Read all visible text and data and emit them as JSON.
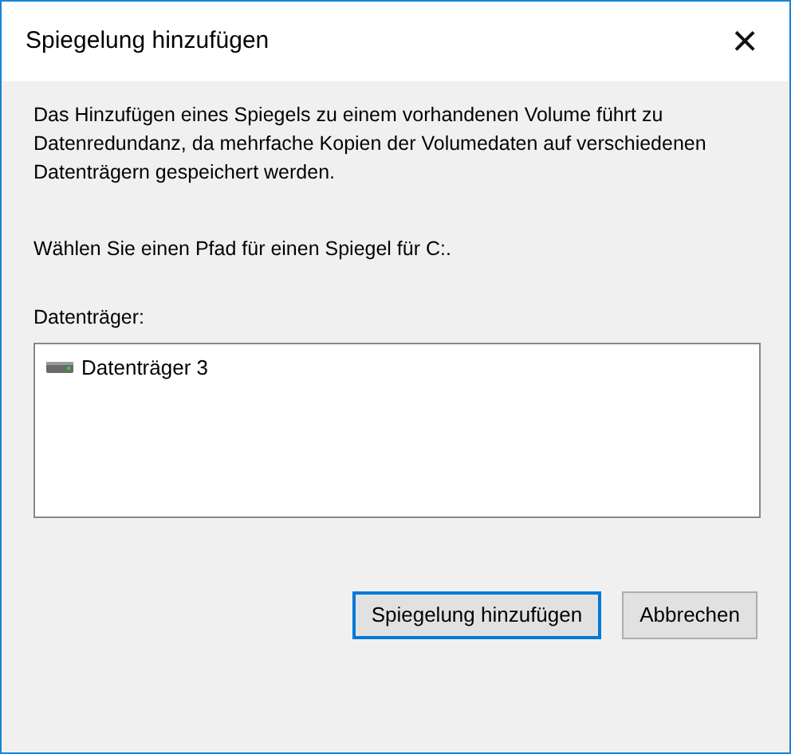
{
  "window": {
    "title": "Spiegelung hinzufügen",
    "close": "×"
  },
  "description": "Das Hinzufügen eines Spiegels zu einem vorhandenen Volume führt zu Datenredundanz, da mehrfache Kopien der Volumedaten auf verschiedenen Datenträgern gespeichert werden.",
  "prompt": "Wählen Sie einen Pfad für einen Spiegel für C:.",
  "disk_list": {
    "label": "Datenträger:",
    "items": [
      {
        "label": "Datenträger 3",
        "selected": false
      }
    ]
  },
  "buttons": [
    {
      "label": "Spiegelung hinzufügen",
      "default": true
    },
    {
      "label": "Abbrechen",
      "default": false
    }
  ]
}
